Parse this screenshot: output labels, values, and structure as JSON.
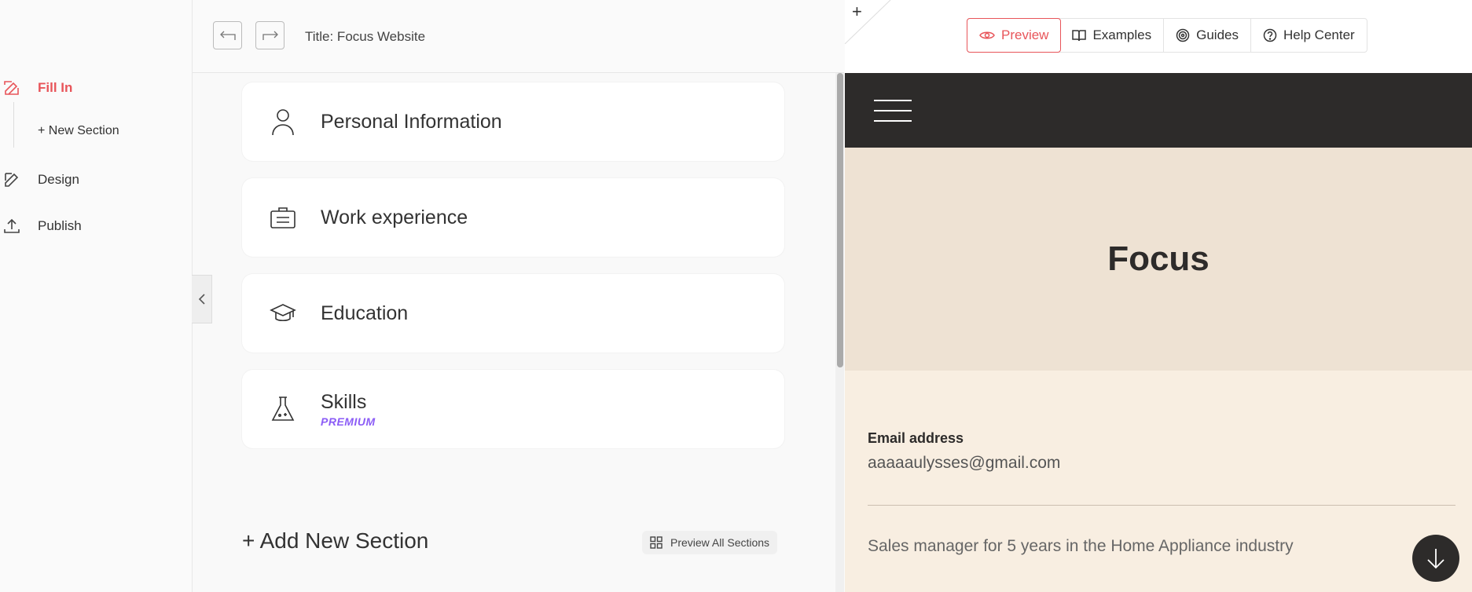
{
  "nav": {
    "fill_in": "Fill In",
    "new_section": "+ New Section",
    "design": "Design",
    "publish": "Publish"
  },
  "editor": {
    "title": "Title: Focus Website",
    "sections": [
      {
        "label": "Personal Information",
        "icon": "person-icon"
      },
      {
        "label": "Work experience",
        "icon": "briefcase-icon"
      },
      {
        "label": "Education",
        "icon": "graduation-cap-icon"
      },
      {
        "label": "Skills",
        "icon": "flask-icon",
        "badge": "PREMIUM"
      }
    ],
    "add_section": "+ Add New Section",
    "preview_all": "Preview All Sections"
  },
  "tabs": {
    "preview": "Preview",
    "examples": "Examples",
    "guides": "Guides",
    "help_center": "Help Center"
  },
  "site": {
    "name": "Focus",
    "email_label": "Email address",
    "email_value": "aaaaaulysses@gmail.com",
    "summary": "Sales manager for 5 years in the Home Appliance industry"
  },
  "colors": {
    "accent": "#e8555a",
    "premium": "#8b5cf6",
    "site_dark": "#2d2b2a",
    "hero_bg": "#eee2d3",
    "body_bg": "#f8eee1"
  }
}
